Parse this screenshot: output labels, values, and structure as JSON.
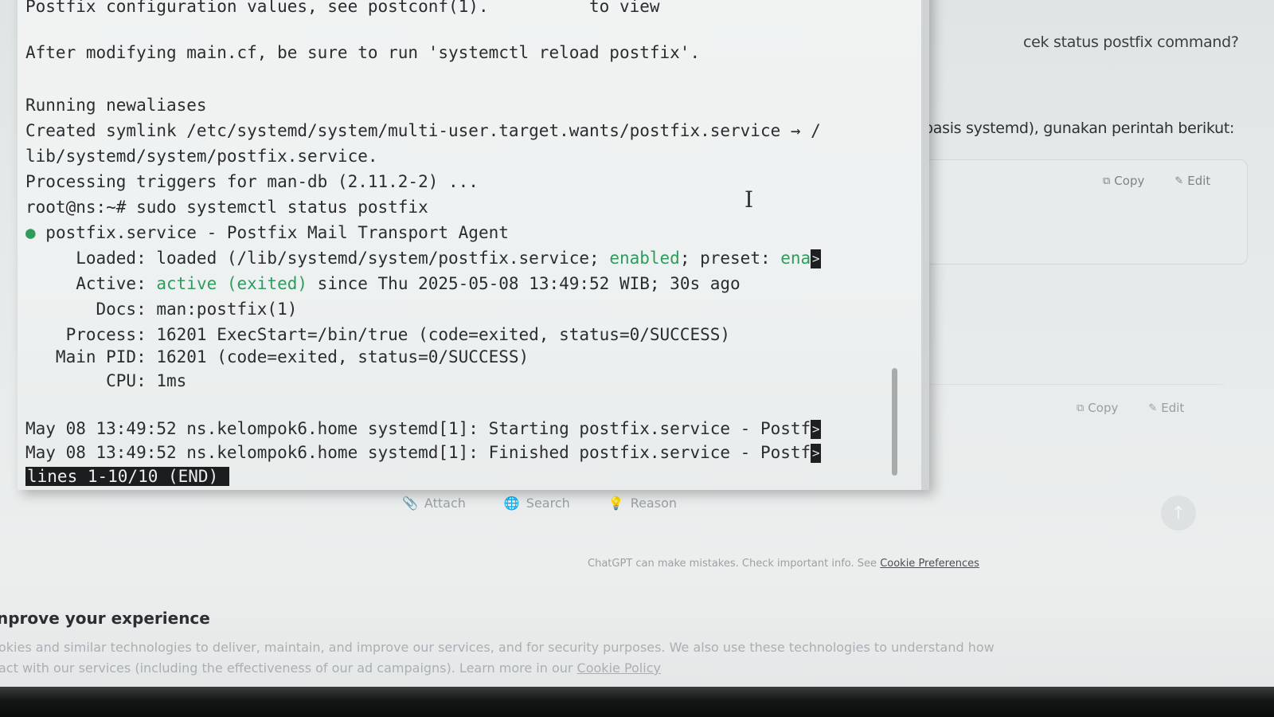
{
  "chat": {
    "user_message": "cek status postfix command?",
    "assistant_line": "basis systemd), gunakan perintah berikut:",
    "code_block_1": {
      "copy_label": "Copy",
      "edit_label": "Edit"
    },
    "code_block_2": {
      "copy_label": "Copy",
      "edit_label": "Edit"
    },
    "composer": {
      "attach_label": "Attach",
      "search_label": "Search",
      "reason_label": "Reason",
      "send_icon": "arrow-up-icon"
    },
    "disclaimer_text": "ChatGPT can make mistakes. Check important info. See",
    "disclaimer_link": "Cookie Preferences"
  },
  "cookie_banner": {
    "title": "nprove your experience",
    "line1": "okies and similar technologies to deliver, maintain, and improve our services, and for security purposes. We also use these technologies to understand how",
    "line2_prefix": "act with our services (including the effectiveness of our ad campaigns). Learn more in our",
    "line2_link": "Cookie Policy"
  },
  "terminal": {
    "lines": {
      "l0": "Postfix configuration values, see postconf(1).",
      "l0_right": "to view",
      "l1": "After modifying main.cf, be sure to run 'systemctl reload postfix'.",
      "l2": "Running newaliases",
      "l3": "Created symlink /etc/systemd/system/multi-user.target.wants/postfix.service → /",
      "l4": "lib/systemd/system/postfix.service.",
      "l5": "Processing triggers for man-db (2.11.2-2) ...",
      "l6": "root@ns:~# sudo systemctl status postfix",
      "l7_bullet": "●",
      "l7": " postfix.service - Postfix Mail Transport Agent",
      "l8_a": "     Loaded: loaded (/lib/systemd/system/postfix.service; ",
      "l8_b": "enabled",
      "l8_c": "; preset: ",
      "l8_d": "ena",
      "l9_a": "     Active: ",
      "l9_b": "active (exited)",
      "l9_c": " since Thu 2025-05-08 13:49:52 WIB; 30s ago",
      "l10": "       Docs: man:postfix(1)",
      "l11": "    Process: 16201 ExecStart=/bin/true (code=exited, status=0/SUCCESS)",
      "l12": "   Main PID: 16201 (code=exited, status=0/SUCCESS)",
      "l13": "        CPU: 1ms",
      "l14": "May 08 13:49:52 ns.kelompok6.home systemd[1]: Starting postfix.service - Postf",
      "l15": "May 08 13:49:52 ns.kelompok6.home systemd[1]: Finished postfix.service - Postf",
      "truncation_mark": ">",
      "pager_status": "lines 1-10/10 (END)"
    }
  }
}
